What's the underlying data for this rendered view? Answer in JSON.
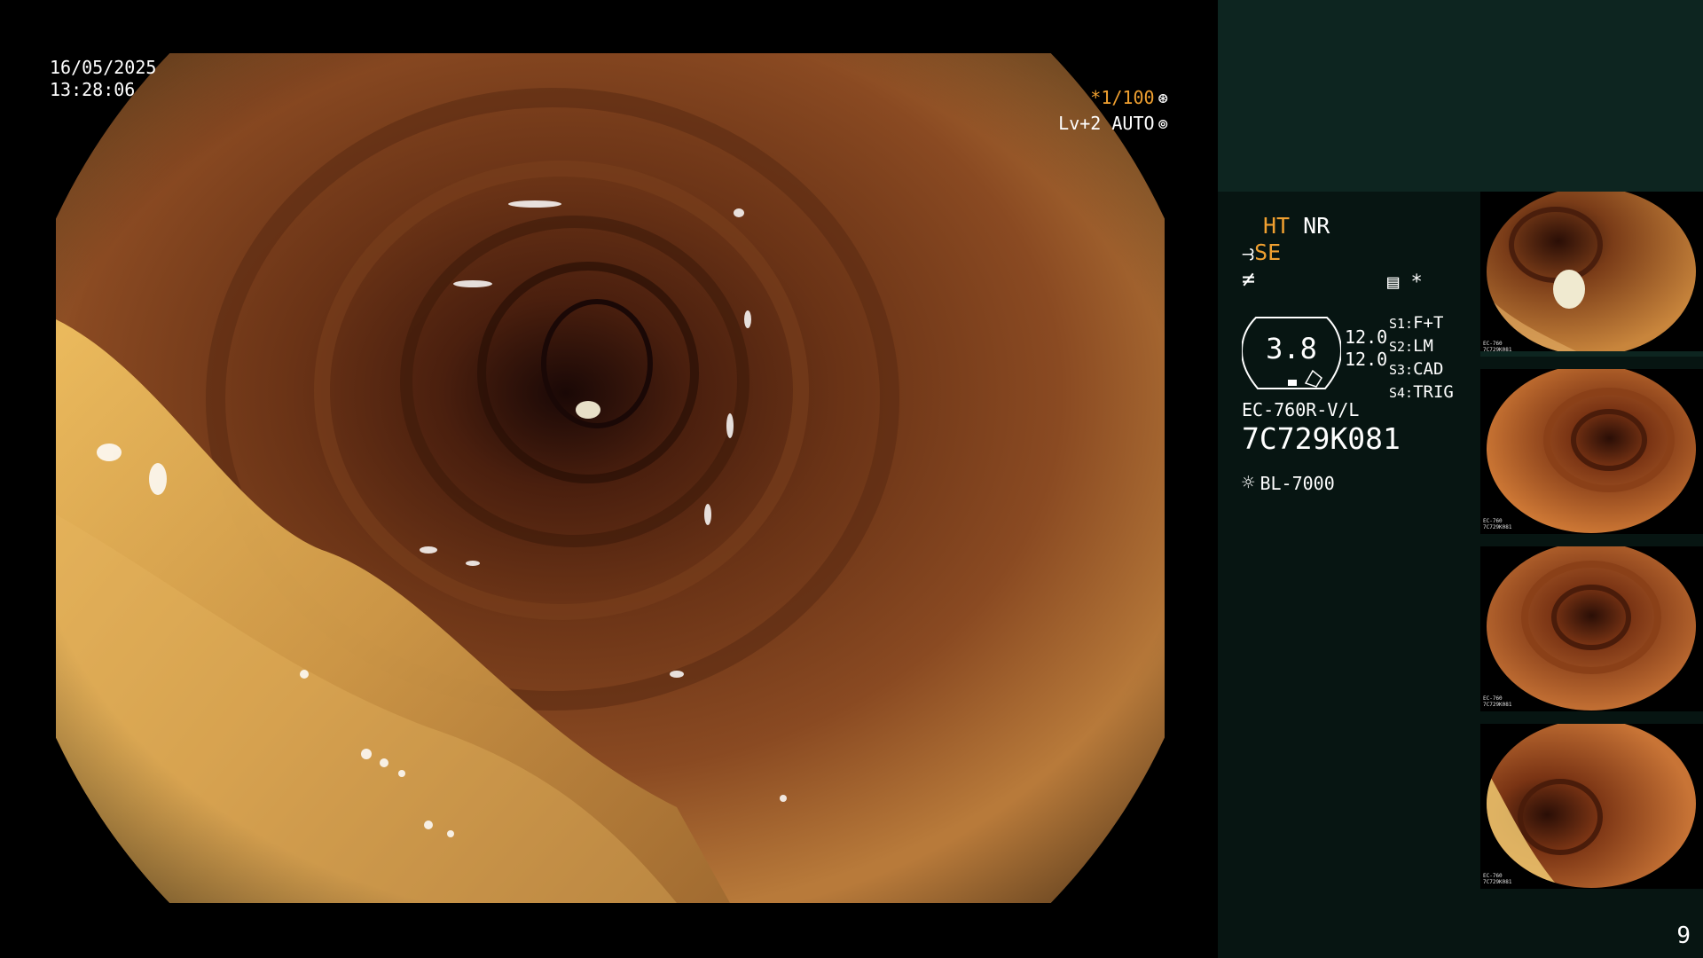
{
  "osd": {
    "date": "16/05/2025",
    "time": "13:28:06",
    "shutter": "*1/100",
    "shutter_icon": "shutter-icon",
    "level": "Lv+2 AUTO",
    "level_icon": "iris-icon"
  },
  "panel": {
    "mode_ht": "HT",
    "mode_nr": "NR",
    "mode_se": "SE",
    "mode_se_icon": "enhance-icon",
    "blur_icon": "freeze-icon",
    "menu_icon": "menu-icon",
    "star": "*",
    "gauge_value": "3.8",
    "gauge_icon": "pump-icon",
    "aux_values": [
      "12.0",
      "12.0"
    ],
    "switches": [
      {
        "key": "S1:",
        "value": "F+T"
      },
      {
        "key": "S2:",
        "value": "LM"
      },
      {
        "key": "S3:",
        "value": "CAD"
      },
      {
        "key": "S4:",
        "value": "TRIG"
      }
    ],
    "scope_model": "EC-760R-V/L",
    "scope_serial": "7C729K081",
    "light_source": "BL-7000",
    "light_icon": "light-source-icon"
  },
  "thumbnails": [
    {
      "caption_model": "EC-760",
      "caption_serial": "7C729K081"
    },
    {
      "caption_model": "EC-760",
      "caption_serial": "7C729K081"
    },
    {
      "caption_model": "EC-760",
      "caption_serial": "7C729K081"
    },
    {
      "caption_model": "EC-760",
      "caption_serial": "7C729K081"
    }
  ],
  "page_number": "9",
  "colors": {
    "osd_accent": "#f0a030",
    "panel_top": "#0d2520",
    "panel_bottom": "#071512",
    "mucosa": "#8a4a22",
    "lumen": "#1a0806"
  }
}
